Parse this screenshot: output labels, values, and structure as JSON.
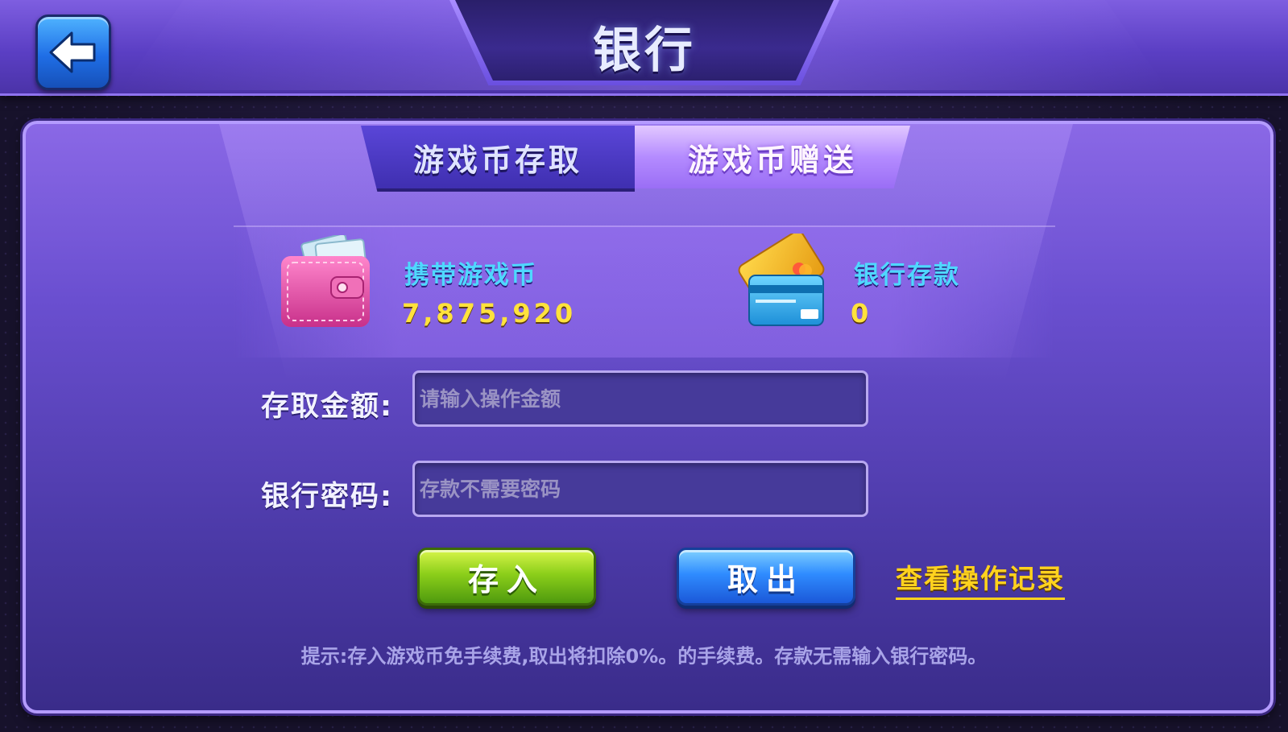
{
  "header": {
    "title": "银行",
    "back_icon": "back-arrow-icon"
  },
  "tabs": [
    {
      "label": "游戏币存取",
      "active": false
    },
    {
      "label": "游戏币赠送",
      "active": true
    }
  ],
  "balances": {
    "carried": {
      "label": "携带游戏币",
      "value": "7,875,920",
      "icon": "wallet-icon"
    },
    "bank": {
      "label": "银行存款",
      "value": "0",
      "icon": "bank-card-icon"
    }
  },
  "form": {
    "amount_label": "存取金额:",
    "amount_placeholder": "请输入操作金额",
    "password_label": "银行密码:",
    "password_placeholder": "存款不需要密码"
  },
  "actions": {
    "deposit_label": "存入",
    "withdraw_label": "取出",
    "record_link": "查看操作记录"
  },
  "tip": "提示:存入游戏币免手续费,取出将扣除0%。的手续费。存款无需输入银行密码。",
  "colors": {
    "accent_cyan": "#4fd8ff",
    "value_yellow": "#ffe23c",
    "link_gold": "#ffd21e",
    "deposit_green": "#8ccf1a",
    "withdraw_blue": "#2f8cff"
  }
}
